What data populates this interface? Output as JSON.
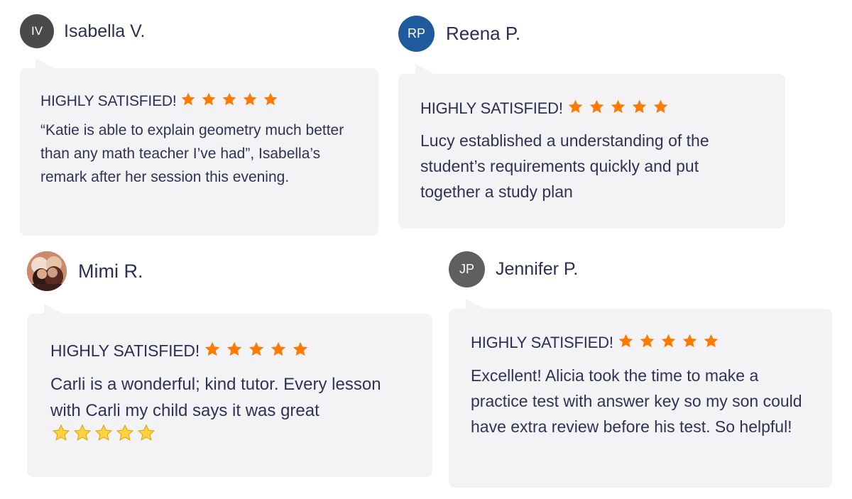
{
  "colors": {
    "card_bg": "#f3f3f6",
    "star": "#ff7a00",
    "text": "#2e3452",
    "avatar_iv": "#4a4a4a",
    "avatar_rp": "#1f5a9c",
    "avatar_jp": "#5f5f62",
    "emoji_star": "#ffd23f"
  },
  "reviews": [
    {
      "reviewer_name": "Isabella V.",
      "avatar_initials": "IV",
      "headline": "HIGHLY SATISFIED!",
      "rating": 5,
      "text": "“Katie is able to explain geometry much better than any math teacher I’ve had”, Isabella’s remark after her session this evening."
    },
    {
      "reviewer_name": "Reena P.",
      "avatar_initials": "RP",
      "headline": "HIGHLY SATISFIED!",
      "rating": 5,
      "text": "Lucy established a understanding of the student’s requirements quickly and put together a study plan"
    },
    {
      "reviewer_name": "Mimi R.",
      "avatar_initials": "",
      "avatar_icon": "user-photo",
      "headline": "HIGHLY SATISFIED!",
      "rating": 5,
      "text": "Carli is a wonderful; kind tutor. Every lesson with Carli my child says it was great",
      "text_emoji_stars": 5
    },
    {
      "reviewer_name": "Jennifer P.",
      "avatar_initials": "JP",
      "headline": "HIGHLY SATISFIED!",
      "rating": 5,
      "text": "Excellent! Alicia took the time to make a practice test with answer key so my son could have extra review before his test. So helpful!"
    }
  ]
}
